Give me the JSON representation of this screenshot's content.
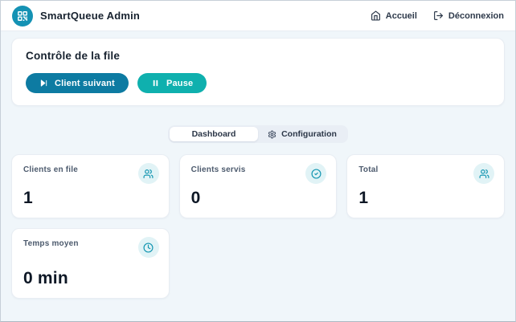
{
  "colors": {
    "background": "#f0f6fa",
    "brand_teal": "#1492b4",
    "primary_button": "#0d7ba2",
    "teal_button": "#0fb0ae",
    "icon_bubble_bg": "#e1f3f6",
    "icon_teal": "#1697b2"
  },
  "header": {
    "title": "SmartQueue Admin",
    "logo_icon": "qr-code-icon",
    "nav": [
      {
        "label": "Accueil",
        "icon": "home-icon"
      },
      {
        "label": "Déconnexion",
        "icon": "logout-icon"
      }
    ]
  },
  "control": {
    "title": "Contrôle de la file",
    "buttons": [
      {
        "label": "Client suivant",
        "icon": "skip-forward-icon",
        "color": "#0d7ba2"
      },
      {
        "label": "Pause",
        "icon": "pause-icon",
        "color": "#0fb0ae"
      }
    ]
  },
  "tabs": [
    {
      "label": "Dashboard",
      "active": true
    },
    {
      "label": "Configuration",
      "icon": "gear-icon",
      "active": false
    }
  ],
  "stats": [
    {
      "label": "Clients en file",
      "value": "1",
      "icon": "users-icon"
    },
    {
      "label": "Clients servis",
      "value": "0",
      "icon": "check-circle-icon"
    },
    {
      "label": "Total",
      "value": "1",
      "icon": "users-icon"
    },
    {
      "label": "Temps moyen",
      "value": "0 min",
      "icon": "clock-icon"
    }
  ]
}
